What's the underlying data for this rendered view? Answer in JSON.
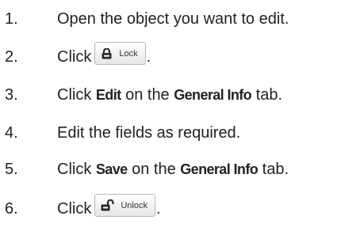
{
  "steps": [
    {
      "num": "1.",
      "parts": [
        "Open the object you want to edit."
      ]
    },
    {
      "num": "2.",
      "lead": "Click",
      "button": {
        "label": "Lock",
        "icon": "lock-icon"
      },
      "trail": "."
    },
    {
      "num": "3.",
      "lead": "Click",
      "b1": "Edit",
      "mid": "on the",
      "b2": "General Info",
      "end": "tab."
    },
    {
      "num": "4.",
      "parts": [
        "Edit the fields as required."
      ]
    },
    {
      "num": "5.",
      "lead": "Click",
      "b1": "Save",
      "mid": "on the",
      "b2": "General Info",
      "end": "tab."
    },
    {
      "num": "6.",
      "lead": "Click",
      "button": {
        "label": "Unlock",
        "icon": "unlock-icon"
      },
      "trail": "."
    }
  ]
}
